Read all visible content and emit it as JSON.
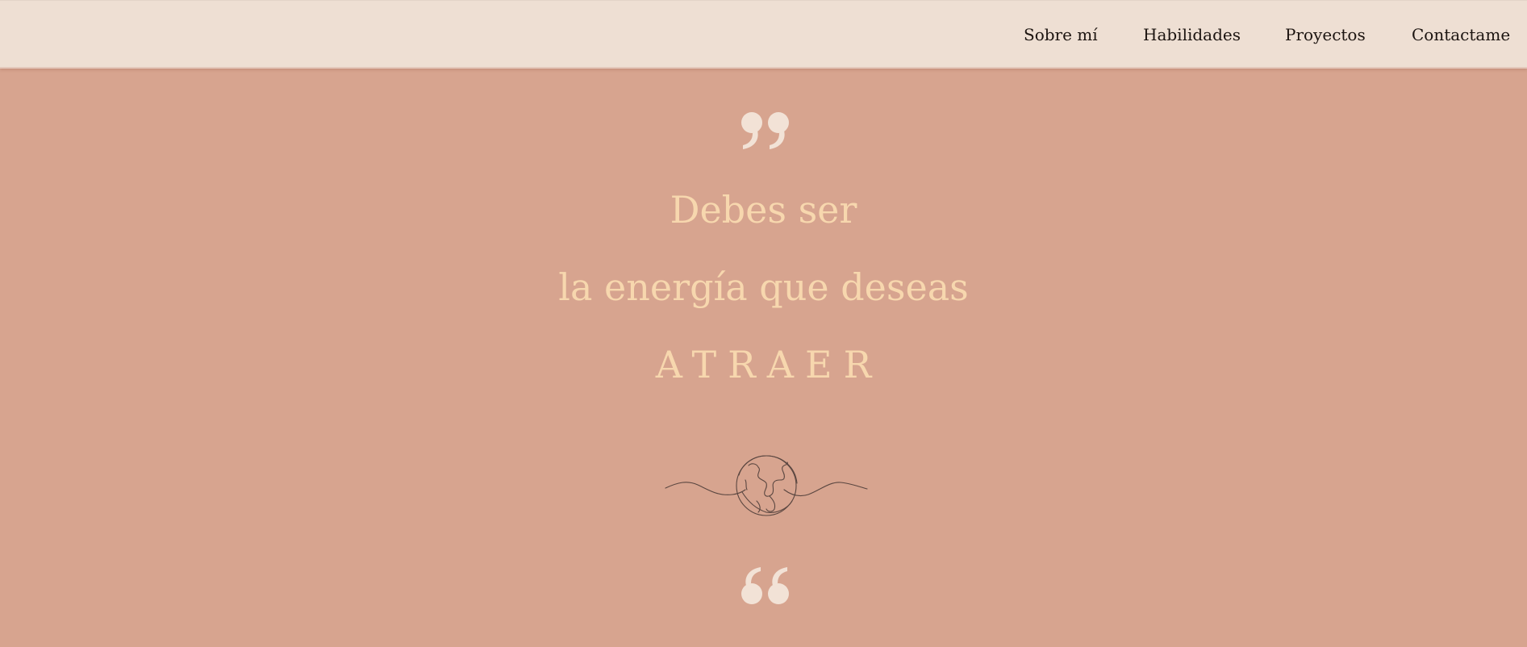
{
  "nav": {
    "items": [
      {
        "label": "Sobre mí"
      },
      {
        "label": "Habilidades"
      },
      {
        "label": "Proyectos"
      },
      {
        "label": "Contactame"
      }
    ]
  },
  "hero": {
    "line1": "Debes ser",
    "line2": "la energía que deseas",
    "line3": "ATRAER"
  },
  "icons": {
    "quote_top": "closing-quote-icon",
    "ornament": "earth-line-drawing",
    "quote_bottom": "opening-quote-icon"
  },
  "colors": {
    "nav_background": "#eedfd3",
    "page_background": "#d7a48f",
    "hero_text": "#f7d7ae",
    "quote_marks": "#f2e2d6",
    "nav_text": "#1c1410"
  }
}
